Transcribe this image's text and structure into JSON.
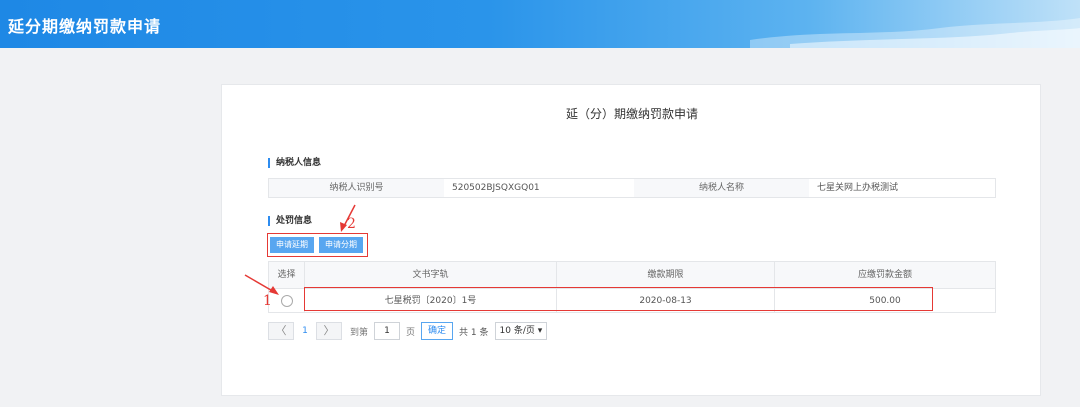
{
  "header": {
    "title": "延分期缴纳罚款申请"
  },
  "page": {
    "title": "延（分）期缴纳罚款申请"
  },
  "taxpayer": {
    "section_label": "纳税人信息",
    "id_label": "纳税人识别号",
    "id_value": "520502BJSQXGQ01",
    "name_label": "纳税人名称",
    "name_value": "七星关网上办税测试"
  },
  "penalty": {
    "section_label": "处罚信息",
    "buttons": {
      "delay": "申请延期",
      "installment": "申请分期"
    },
    "columns": [
      "选择",
      "文书字轨",
      "缴款期限",
      "应缴罚款金额"
    ],
    "rows": [
      {
        "doc": "七星税罚〔2020〕1号",
        "deadline": "2020-08-13",
        "amount": "500.00"
      }
    ]
  },
  "pager": {
    "prev": "〈",
    "page": "1",
    "next": "〉",
    "goto_label": "到第",
    "goto_value": "1",
    "page_unit": "页",
    "confirm": "确定",
    "total": "共 1 条",
    "page_size": "10 条/页 ▾"
  },
  "annotations": {
    "mark1": "1",
    "mark2": "2"
  },
  "colors": {
    "accent": "#2d8cf0",
    "button": "#58a6f0",
    "highlight": "#e53935",
    "header": "#1e88e5"
  }
}
